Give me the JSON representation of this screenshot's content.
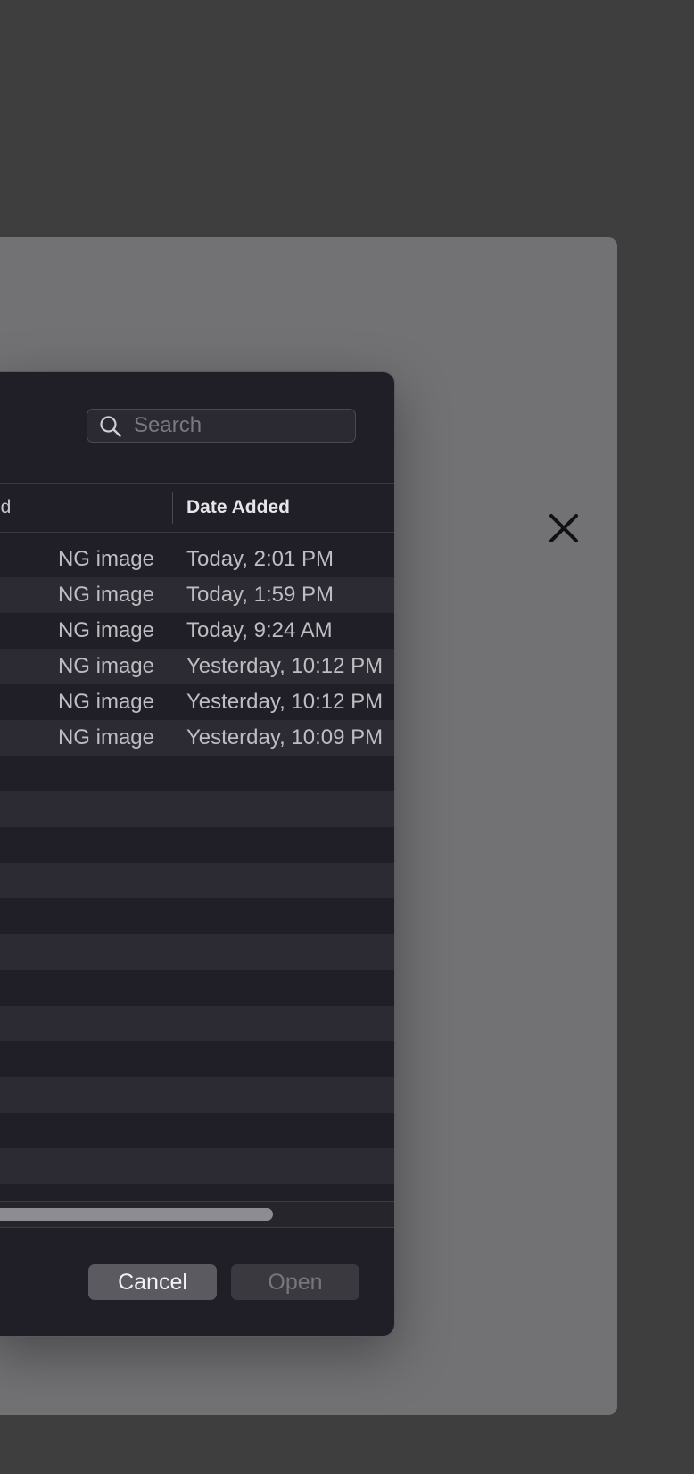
{
  "close_label": "close",
  "search": {
    "placeholder": "Search",
    "value": ""
  },
  "columns": {
    "kind": "nd",
    "date_added": "Date Added"
  },
  "rows": [
    {
      "kind": "NG image",
      "date": "Today, 2:01 PM"
    },
    {
      "kind": "NG image",
      "date": "Today, 1:59 PM"
    },
    {
      "kind": "NG image",
      "date": "Today, 9:24 AM"
    },
    {
      "kind": "NG image",
      "date": "Yesterday, 10:12 PM"
    },
    {
      "kind": "NG image",
      "date": "Yesterday, 10:12 PM"
    },
    {
      "kind": "NG image",
      "date": "Yesterday, 10:09 PM"
    }
  ],
  "buttons": {
    "cancel": "Cancel",
    "open": "Open"
  },
  "colors": {
    "background": "#3e3e3e",
    "overlay_panel": "#727274",
    "dialog": "#201f27",
    "row_alt": "#2c2b33"
  }
}
